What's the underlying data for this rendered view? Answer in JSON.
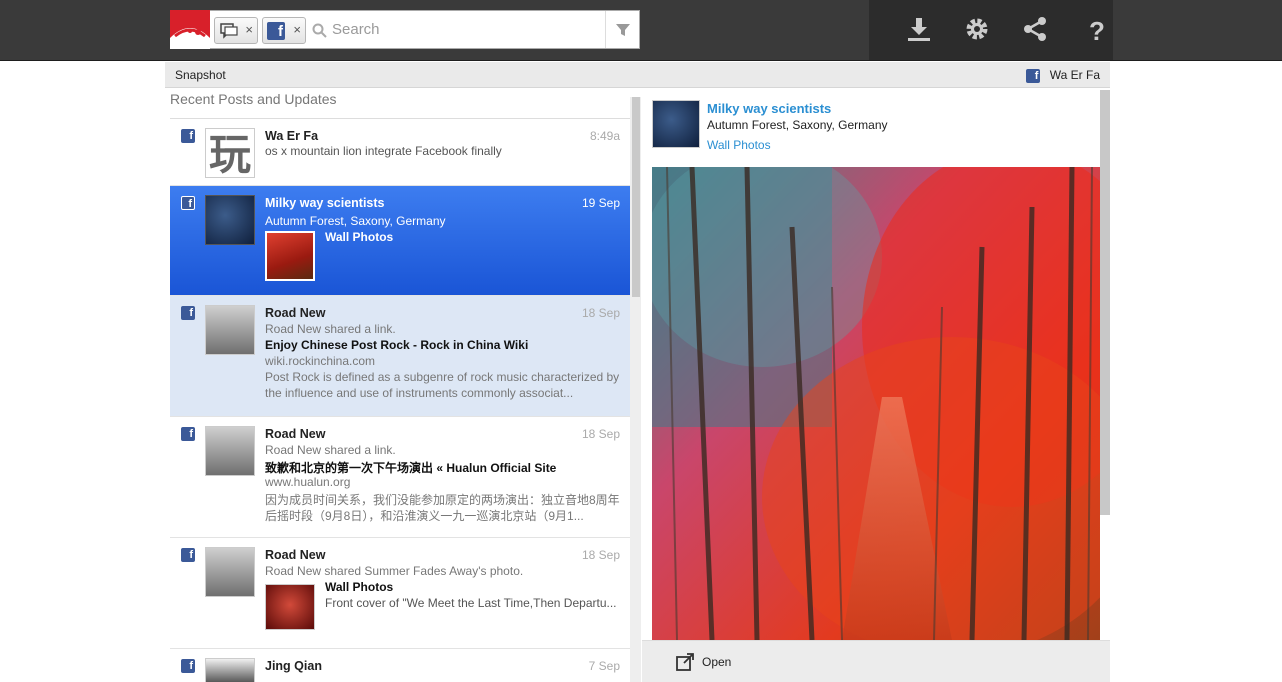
{
  "toolbar": {
    "search_placeholder": "Search",
    "chips": [
      {
        "icon": "chat-stream-icon",
        "remove": "×"
      },
      {
        "icon": "facebook-icon",
        "remove": "×"
      }
    ],
    "icons": [
      "download-icon",
      "gear-icon",
      "share-icon",
      "help-icon"
    ]
  },
  "snapshot": {
    "label": "Snapshot",
    "user": "Wa Er Fa",
    "fb_glyph": "f"
  },
  "feed": {
    "heading": "Recent Posts and Updates",
    "posts": [
      {
        "name": "Wa Er Fa",
        "time": "8:49a",
        "lines": [
          "os x mountain lion integrate Facebook finally"
        ],
        "avatar_text": "玩"
      },
      {
        "name": "Milky way scientists",
        "time": "19 Sep",
        "lines": [
          "Autumn Forest, Saxony, Germany"
        ],
        "attachment": "Wall Photos"
      },
      {
        "name": "Road New",
        "time": "18 Sep",
        "lines": [
          "Road New shared a link.",
          "Enjoy Chinese Post Rock - Rock in China Wiki",
          "wiki.rockinchina.com",
          "Post Rock is defined as a subgenre of rock music characterized by",
          "the influence and use of instruments commonly associat..."
        ]
      },
      {
        "name": "Road New",
        "time": "18 Sep",
        "lines": [
          "Road New shared a link.",
          "致歉和北京的第一次下午场演出 « Hualun Official Site",
          "www.hualun.org",
          "因为成员时间关系，我们没能参加原定的两场演出：独立音地8周年",
          "后摇时段（9月8日），和沿淮演义一九一巡演北京站（9月1..."
        ]
      },
      {
        "name": "Road New",
        "time": "18 Sep",
        "lines": [
          "Road New shared Summer Fades Away's photo."
        ],
        "attachment": "Wall Photos",
        "attachment_desc": "Front cover of \"We Meet the Last Time,Then Departu..."
      },
      {
        "name": "Jing Qian",
        "time": "7 Sep",
        "lines": []
      }
    ]
  },
  "detail": {
    "name": "Milky way scientists",
    "location": "Autumn Forest, Saxony, Germany",
    "album": "Wall Photos",
    "open_label": "Open"
  },
  "colors": {
    "topbar": "#3a3a3a",
    "selected": "#2a66e0",
    "link": "#2b8fd2",
    "facebook": "#3b5998",
    "brand_red": "#d8202a"
  }
}
